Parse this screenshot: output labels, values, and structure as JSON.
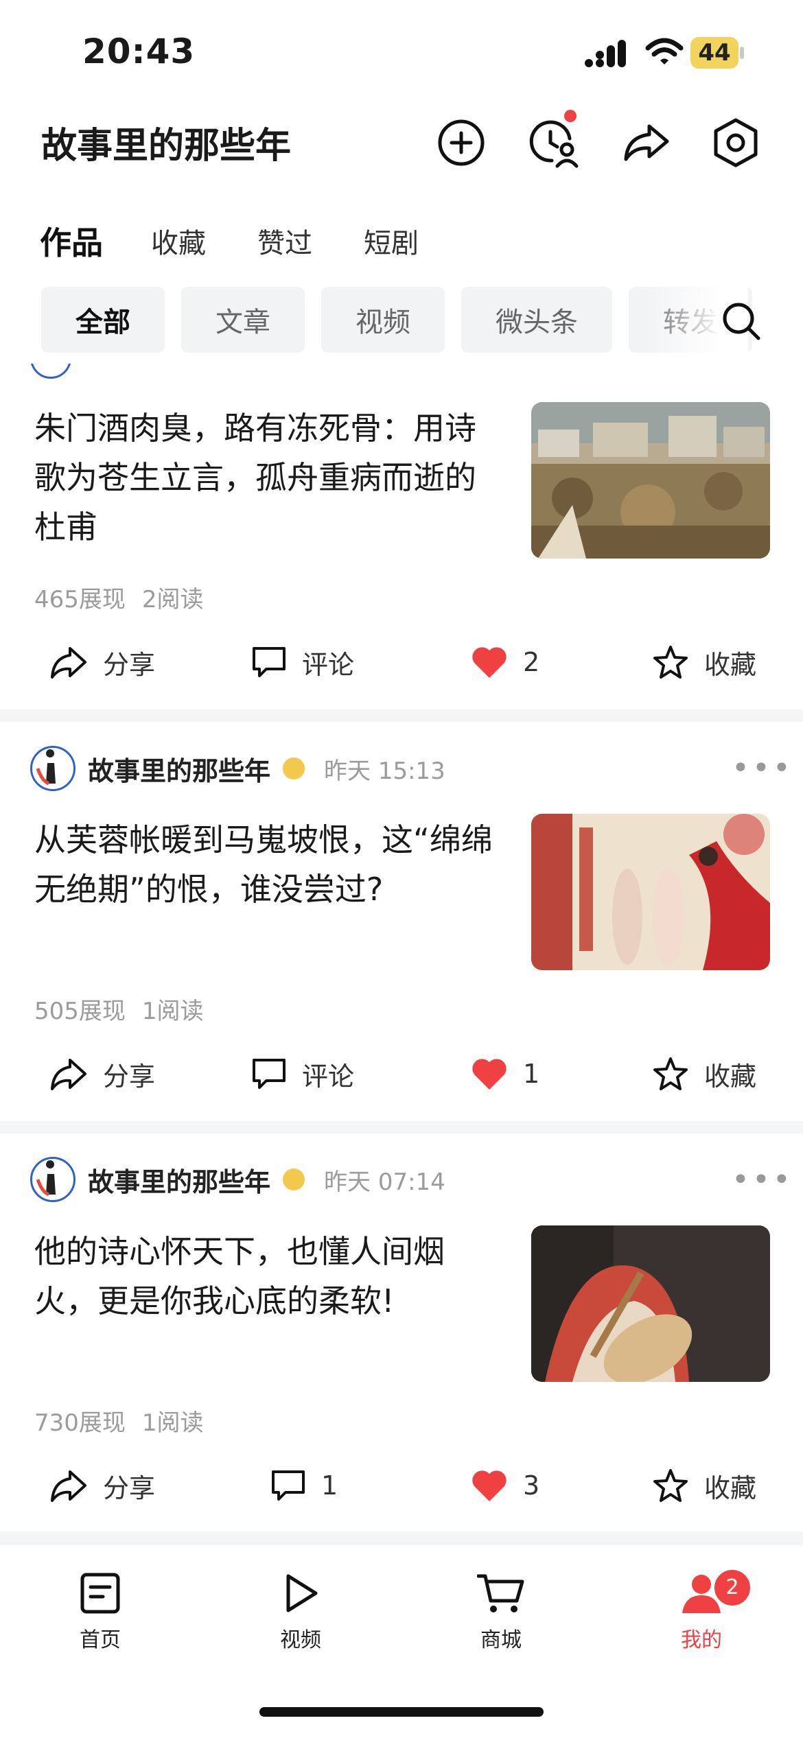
{
  "status_bar": {
    "time": "20:43",
    "battery": "44"
  },
  "header": {
    "title": "故事里的那些年"
  },
  "main_tabs": [
    "作品",
    "收藏",
    "赞过",
    "短剧"
  ],
  "filter_chips": [
    "全部",
    "文章",
    "视频",
    "微头条",
    "转发"
  ],
  "articles": [
    {
      "title": "朱门酒肉臭，路有冻死骨：用诗歌为苍生立言，孤舟重病而逝的杜甫",
      "views": "465展现",
      "reads": "2阅读",
      "share_label": "分享",
      "comment_label": "评论",
      "likes": "2",
      "fav_label": "收藏"
    },
    {
      "author": "故事里的那些年",
      "time": "昨天 15:13",
      "title": "从芙蓉帐暖到马嵬坡恨，这“绵绵无绝期”的恨，谁没尝过?",
      "views": "505展现",
      "reads": "1阅读",
      "share_label": "分享",
      "comment_label": "评论",
      "likes": "1",
      "fav_label": "收藏"
    },
    {
      "author": "故事里的那些年",
      "time": "昨天 07:14",
      "title": "他的诗心怀天下，也懂人间烟火，更是你我心底的柔软!",
      "views": "730展现",
      "reads": "1阅读",
      "share_label": "分享",
      "comment_count": "1",
      "likes": "3",
      "fav_label": "收藏"
    }
  ],
  "bottom_nav": {
    "items": [
      "首页",
      "视频",
      "商城",
      "我的"
    ],
    "badge": "2"
  },
  "colors": {
    "accent": "#f04142",
    "chip_bg": "#f2f3f5",
    "muted": "#9b9b9b"
  }
}
